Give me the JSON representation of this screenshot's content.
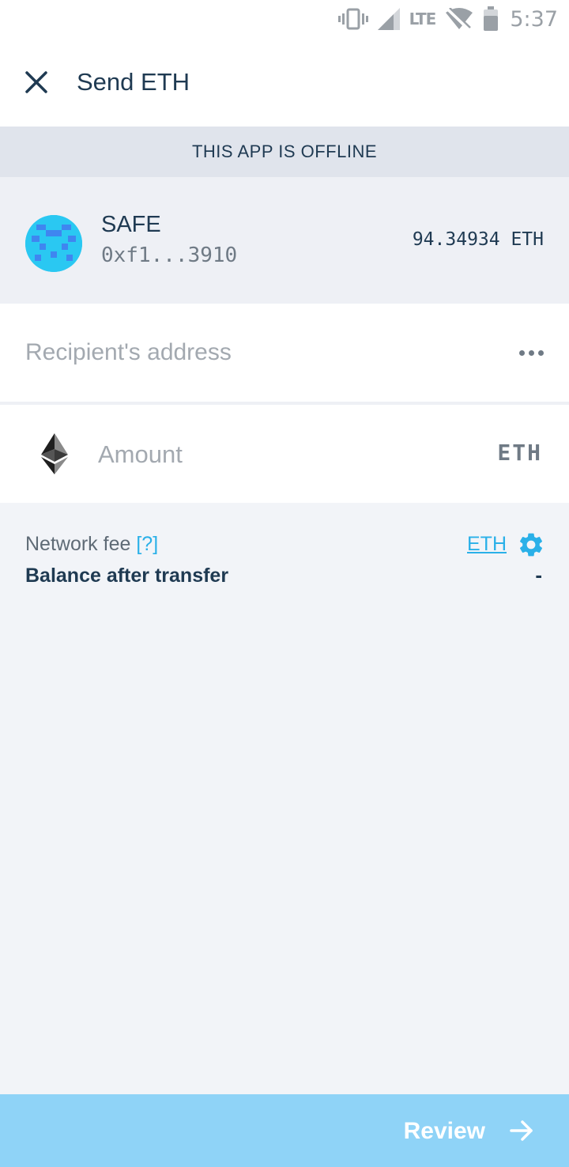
{
  "status_bar": {
    "network_label": "LTE",
    "time": "5:37",
    "icons": [
      "vibrate-icon",
      "signal-icon",
      "wifi-off-icon",
      "battery-icon"
    ]
  },
  "header": {
    "title": "Send ETH",
    "close_icon": "close-icon"
  },
  "banner": {
    "text": "THIS APP IS OFFLINE"
  },
  "account": {
    "name": "SAFE",
    "address": "0xf1...3910",
    "balance": "94.34934 ETH"
  },
  "recipient": {
    "placeholder": "Recipient's address",
    "value": "",
    "more_icon": "more-horizontal-icon"
  },
  "amount": {
    "placeholder": "Amount",
    "value": "",
    "unit": "ETH",
    "icon": "ethereum-icon"
  },
  "fee": {
    "label": "Network fee ",
    "help": "[?]",
    "value": "ETH",
    "settings_icon": "gear-icon"
  },
  "balance_after": {
    "label": "Balance after transfer",
    "value": "-"
  },
  "review": {
    "label": "Review",
    "icon": "arrow-right-icon"
  },
  "colors": {
    "accent": "#2ab0e8",
    "primary_text": "#1f3a52",
    "review_button": "#8fd3f7",
    "banner_bg": "#e0e4ec",
    "page_bg": "#f2f4f8"
  }
}
